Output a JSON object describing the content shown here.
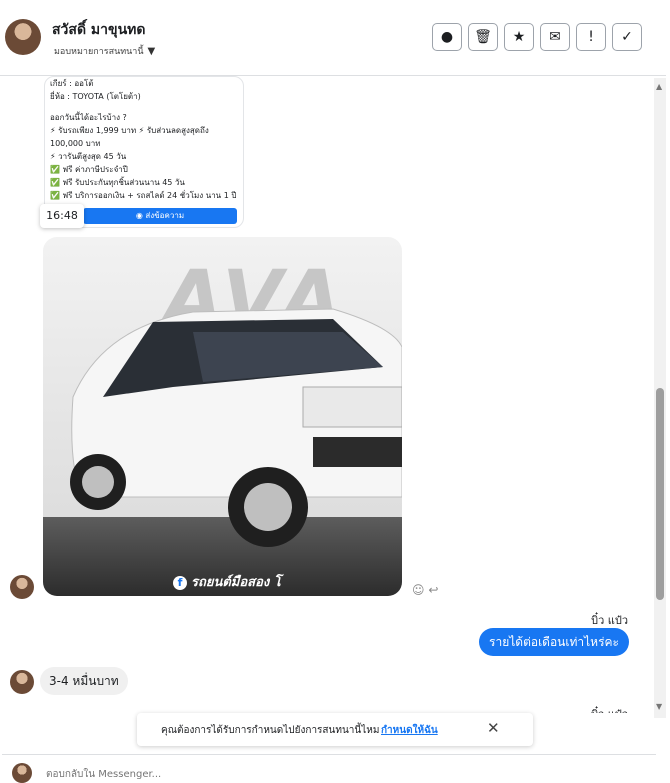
{
  "header": {
    "contact_name": "สวัสดิ์ มาขุนทด",
    "assign_label": "มอบหมายการสนทนานี้"
  },
  "card": {
    "lines": [
      "เกียร์ : ออโต้",
      "ยี่ห้อ : TOYOTA (โตโยต้า)",
      "",
      "ออกวันนี้ได้อะไรบ้าง ?",
      "⚡ รับรถเพียง 1,999 บาท ⚡ รับส่วนลดสูงสุดถึง",
      "100,000 บาท",
      "⚡ วารันตีสูงสุด 45 วัน",
      "✅ ฟรี ค่าภาษีประจำปี",
      "✅ ฟรี รับประกันทุกชิ้นส่วนนาน 45 วัน",
      "✅ ฟรี บริการออกเงิน + รถสไลด์ 24 ชั่วโมง นาน 1 ปี"
    ],
    "send_button": "ส่งข้อความ"
  },
  "timestamp": "16:48",
  "photo": {
    "watermark": "AVA",
    "brand": "รถยนต์มือสอง โ"
  },
  "messages": [
    {
      "sender": "บิ๋ว แป๋ว",
      "text": "รายได้ต่อเดือนเท่าไหร่คะ"
    },
    {
      "text": "3-4 หมื่นบาท"
    },
    {
      "sender": "บิ๋ว แป๋ว"
    }
  ],
  "banner": {
    "text": "คุณต้องการได้รับการกำหนดไปยังการสนทนานี้ไหม",
    "link": "กำหนดให้ฉัน"
  },
  "composer": {
    "placeholder": "ตอบกลับใน Messenger..."
  },
  "colors": {
    "accent": "#1877f2"
  }
}
